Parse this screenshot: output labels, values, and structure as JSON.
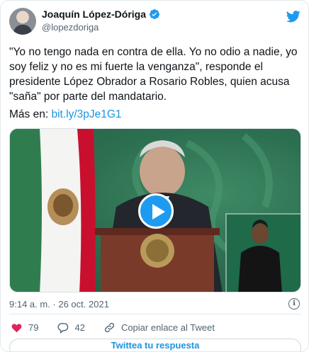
{
  "author": {
    "display_name": "Joaquín López-Dóriga",
    "handle": "@lopezdoriga"
  },
  "tweet": {
    "text": "\"Yo no tengo nada en contra de ella. Yo no odio a nadie, yo soy feliz y no es mi fuerte la venganza\", responde el presidente López Obrador a Rosario Robles, quien acusa \"saña\" por parte del mandatario.",
    "more_prefix": "Más en: ",
    "more_link": "bit.ly/3pJe1G1"
  },
  "meta": {
    "timestamp": "9:14 a. m. · 26 oct. 2021"
  },
  "actions": {
    "likes": "79",
    "replies": "42",
    "copy_link": "Copiar enlace al Tweet"
  },
  "reply_button": "Twittea tu respuesta",
  "colors": {
    "twitter_blue": "#1b95e0",
    "verified": "#1d9bf0",
    "like_red": "#e0245e"
  }
}
